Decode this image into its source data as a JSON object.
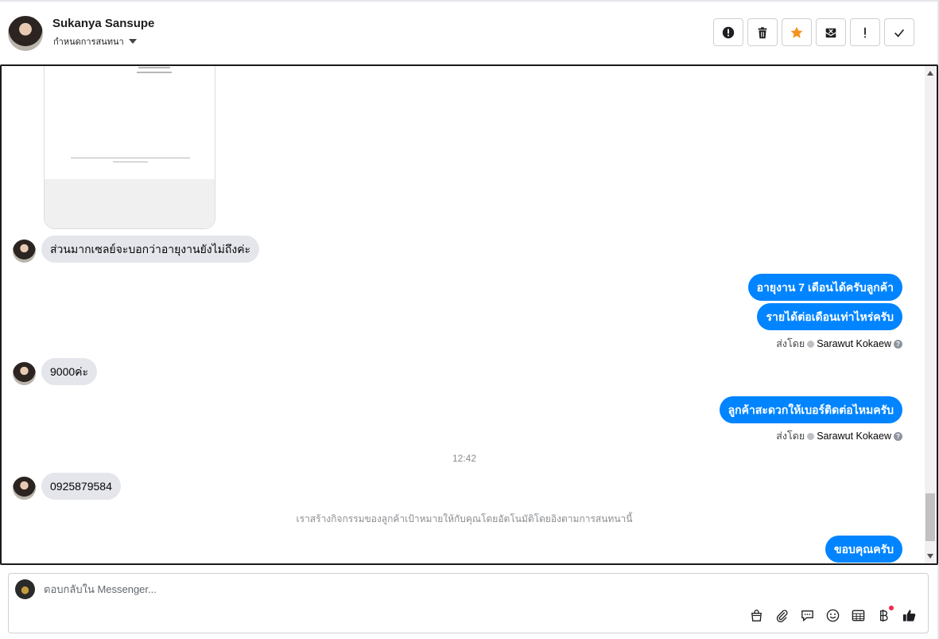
{
  "header": {
    "name": "Sukanya Sansupe",
    "subtitle": "กำหนดการสนทนา",
    "actions": [
      {
        "icon": "alert-circle-icon"
      },
      {
        "icon": "trash-icon"
      },
      {
        "icon": "star-icon",
        "color": "#f5901e"
      },
      {
        "icon": "envelope-x-icon"
      },
      {
        "icon": "exclamation-icon"
      },
      {
        "icon": "checkmark-icon"
      }
    ]
  },
  "conversation": {
    "messages": [
      {
        "dir": "in",
        "text": "ส่วนมากเซลย์จะบอกว่าอายุงานยังไม่ถึงค่ะ"
      },
      {
        "dir": "out",
        "text": "อายุงาน 7 เดือนได้ครับลูกค้า"
      },
      {
        "dir": "out",
        "text": "รายได้ต่อเดือนเท่าไหร่ครับ"
      },
      {
        "dir": "in",
        "text": "9000ค่ะ"
      },
      {
        "dir": "out",
        "text": "ลูกค้าสะดวกให้เบอร์ติดต่อไหมครับ"
      },
      {
        "dir": "in",
        "text": "0925879584"
      },
      {
        "dir": "out",
        "text": "ขอบคุณครับ"
      }
    ],
    "sent_by_label": "ส่งโดย",
    "sent_by_name": "Sarawut Kokaew",
    "time_separator": "12:42",
    "system_note": "เราสร้างกิจกรรมของลูกค้าเป้าหมายให้กับคุณโดยอัตโนมัติโดยอิงตามการสนทนานี้"
  },
  "composer": {
    "placeholder": "ตอบกลับใน Messenger...",
    "tools": [
      "shopping-bag-icon",
      "paperclip-icon",
      "chat-bubble-icon",
      "emoji-icon",
      "table-icon",
      "baht-icon",
      "thumbs-up-icon"
    ]
  },
  "colors": {
    "outgoing_bubble": "#0084ff",
    "incoming_bubble": "#e4e6eb",
    "accent_star": "#f5901e",
    "notification_dot": "#f02849"
  }
}
